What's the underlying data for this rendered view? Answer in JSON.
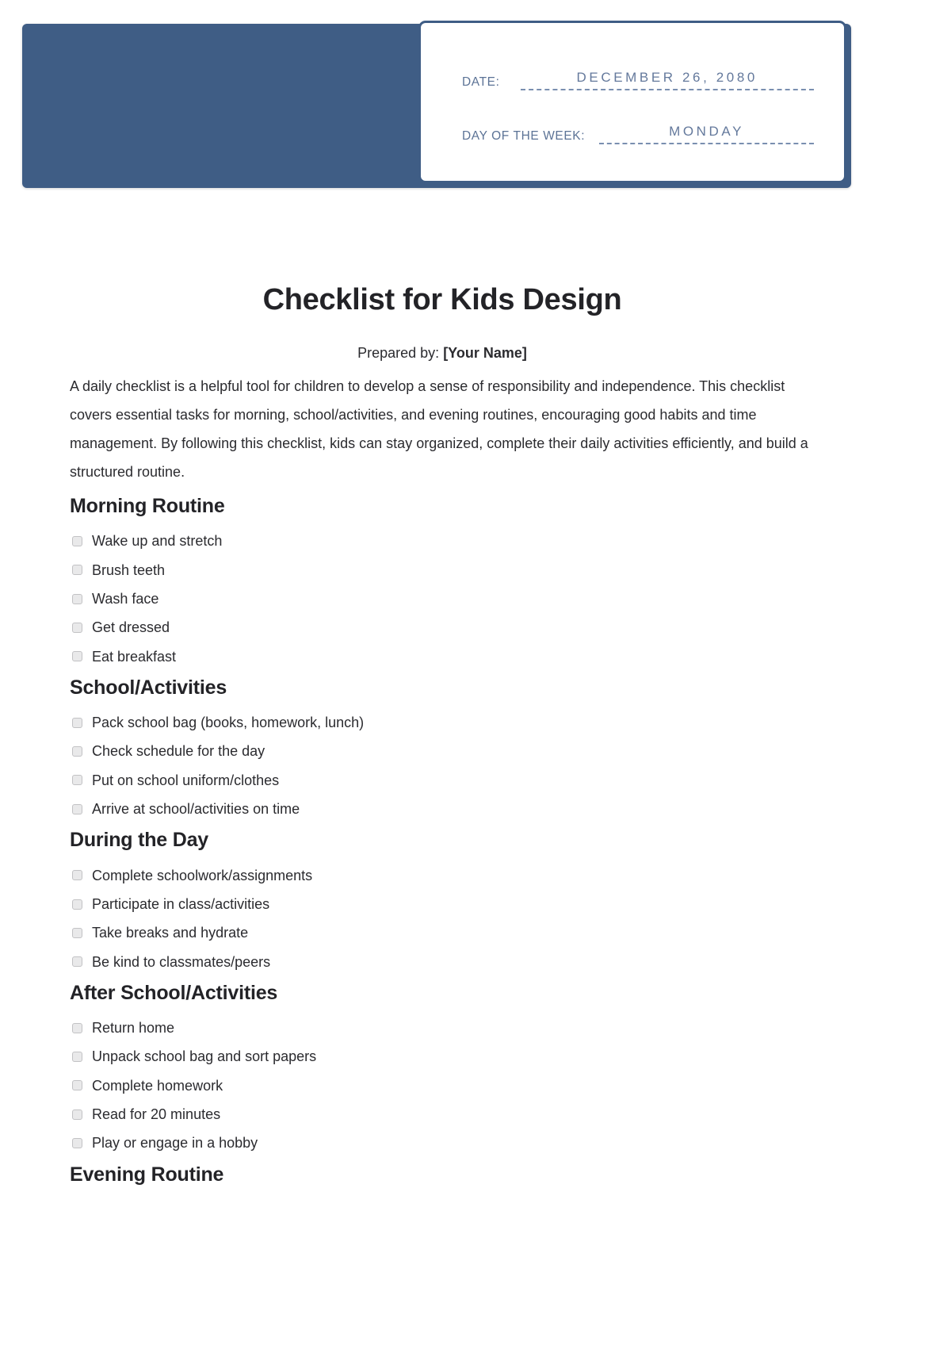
{
  "header": {
    "date_label": "DATE:",
    "date_value": "DECEMBER 26, 2080",
    "day_label": "DAY OF THE WEEK:",
    "day_value": "MONDAY",
    "band_color": "#3f5d85",
    "label_color": "#5c7396",
    "value_color": "#64799c"
  },
  "document": {
    "title": "Checklist for Kids Design",
    "prepared_by_label": "Prepared by:",
    "prepared_by_name": "[Your Name]",
    "intro": "A daily checklist is a helpful tool for children to develop a sense of responsibility and independence. This checklist covers essential tasks for morning, school/activities, and evening routines, encouraging good habits and time management. By following this checklist, kids can stay organized, complete their daily activities efficiently, and build a structured routine.",
    "sections": [
      {
        "heading": "Morning Routine",
        "items": [
          "Wake up and stretch",
          "Brush teeth",
          "Wash face",
          "Get dressed",
          "Eat breakfast"
        ]
      },
      {
        "heading": "School/Activities",
        "items": [
          "Pack school bag (books, homework, lunch)",
          "Check schedule for the day",
          "Put on school uniform/clothes",
          "Arrive at school/activities on time"
        ]
      },
      {
        "heading": "During the Day",
        "items": [
          "Complete schoolwork/assignments",
          "Participate in class/activities",
          "Take breaks and hydrate",
          "Be kind to classmates/peers"
        ]
      },
      {
        "heading": "After School/Activities",
        "items": [
          "Return home",
          "Unpack school bag and sort papers",
          "Complete homework",
          "Read for 20 minutes",
          "Play or engage in a hobby"
        ]
      },
      {
        "heading": "Evening Routine",
        "items": []
      }
    ]
  }
}
